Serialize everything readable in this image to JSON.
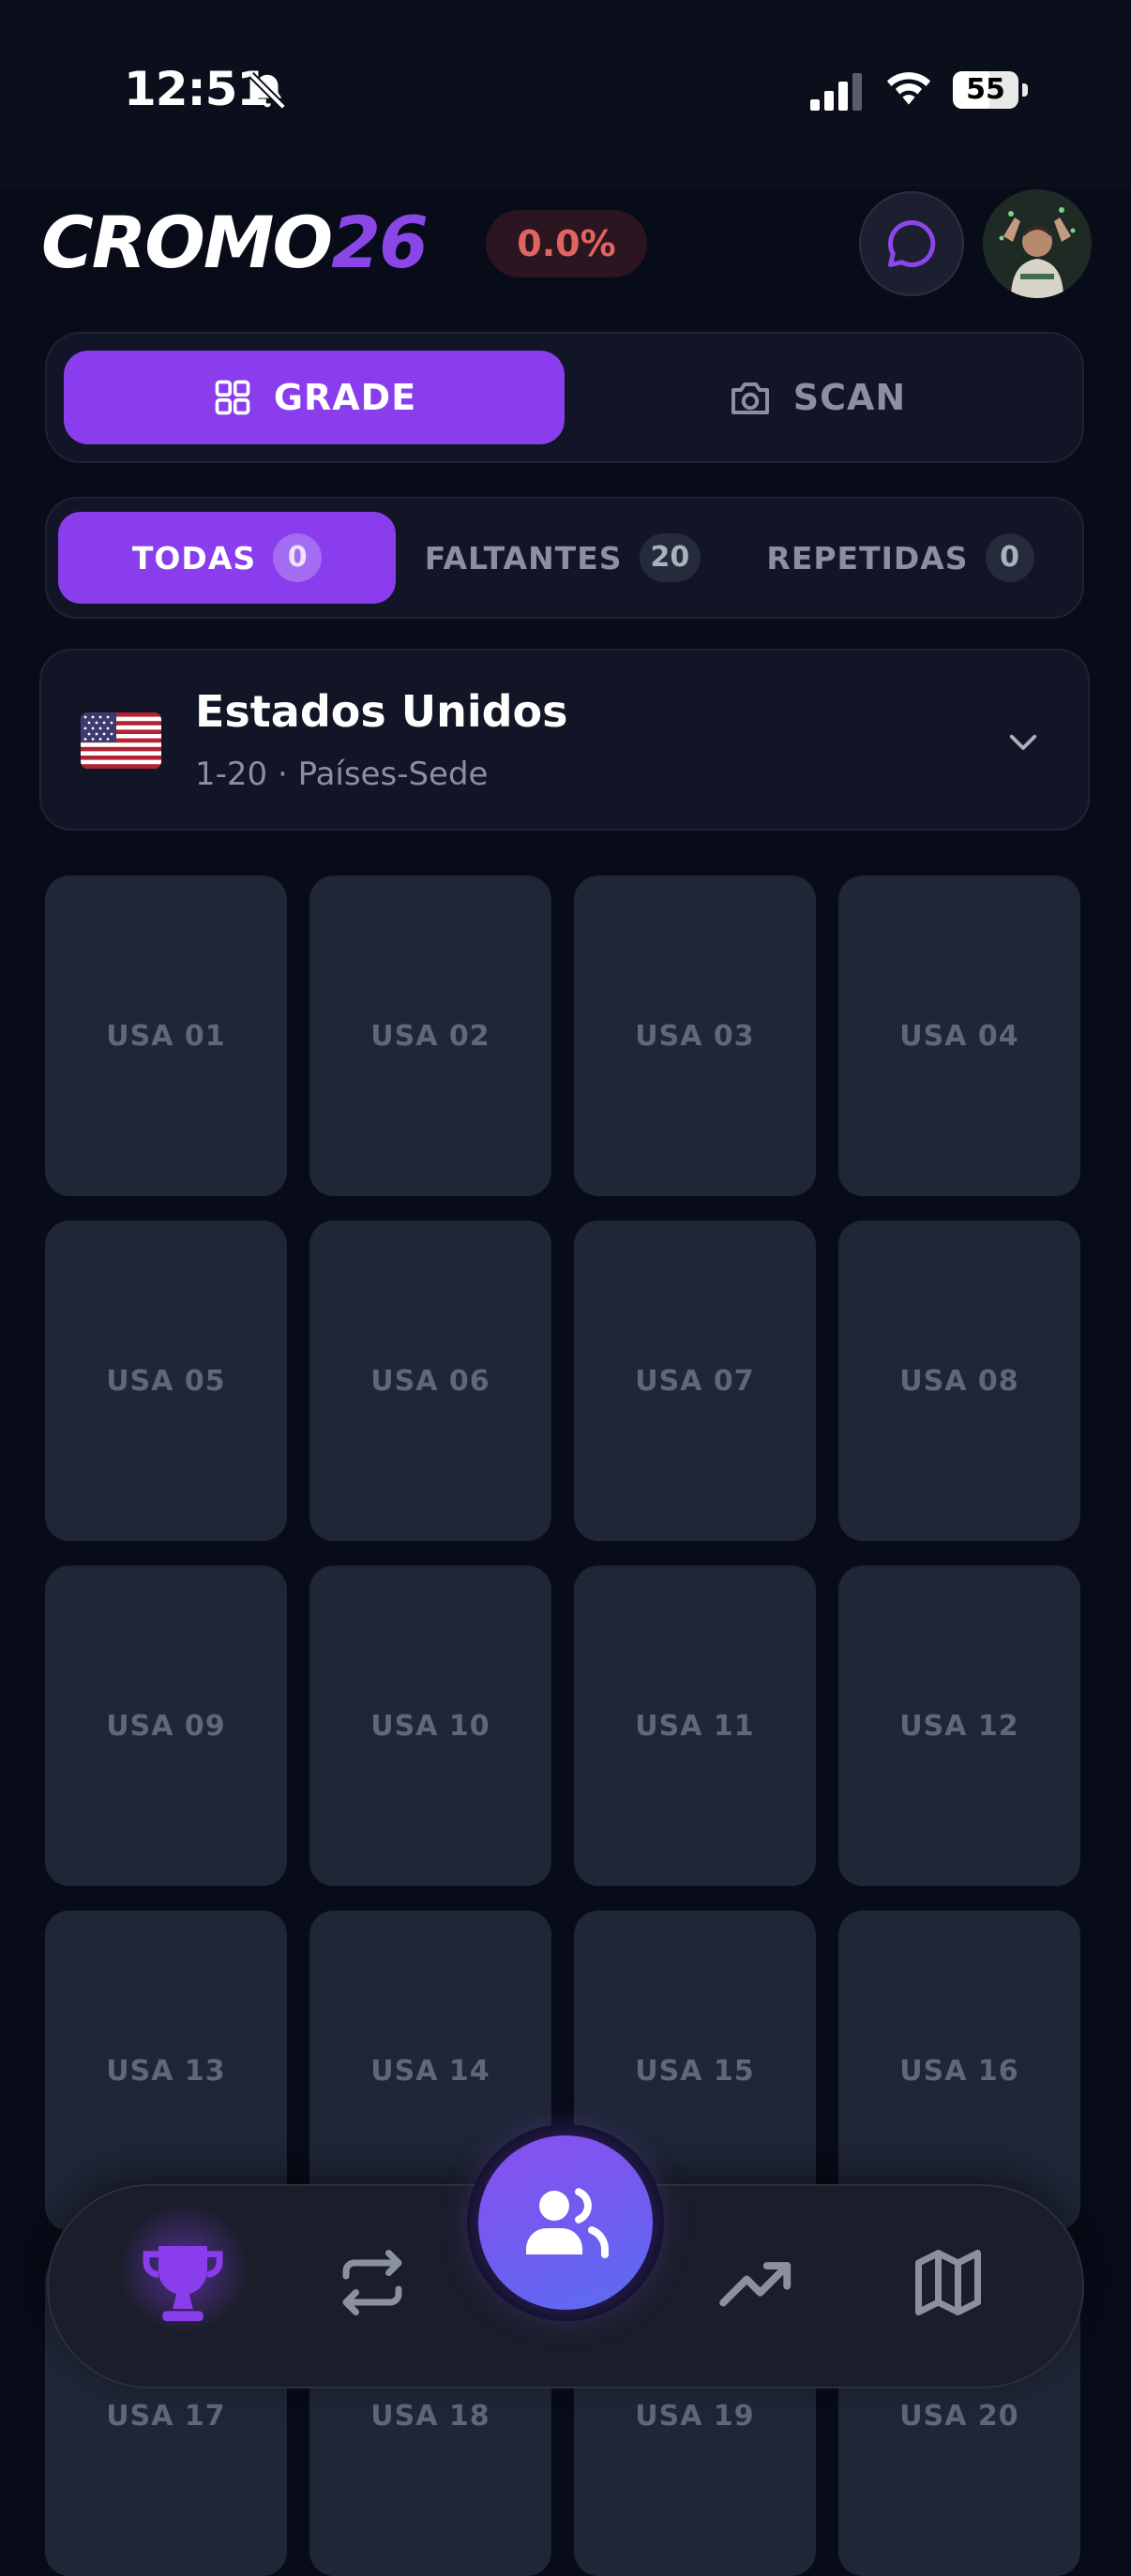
{
  "status_bar": {
    "time": "12:51",
    "battery": "55",
    "battery_level": 0.55
  },
  "header": {
    "logo_part1": "CROMO",
    "logo_part2": "26",
    "progress": "0.0%"
  },
  "mode_toggle": {
    "grade_label": "GRADE",
    "scan_label": "SCAN",
    "active": "GRADE"
  },
  "filters": [
    {
      "label": "TODAS",
      "count": "0",
      "active": true
    },
    {
      "label": "FALTANTES",
      "count": "20",
      "active": false
    },
    {
      "label": "REPETIDAS",
      "count": "0",
      "active": false
    }
  ],
  "country": {
    "name": "Estados Unidos",
    "subtitle": "1-20 · Países-Sede"
  },
  "stickers": [
    "USA 01",
    "USA 02",
    "USA 03",
    "USA 04",
    "USA 05",
    "USA 06",
    "USA 07",
    "USA 08",
    "USA 09",
    "USA 10",
    "USA 11",
    "USA 12",
    "USA 13",
    "USA 14",
    "USA 15",
    "USA 16",
    "USA 17",
    "USA 18",
    "USA 19",
    "USA 20"
  ],
  "nav": {
    "items": [
      "trophy-icon",
      "swap-icon",
      "users-icon",
      "trending-up-icon",
      "map-icon"
    ],
    "accent": "#8a3ded"
  },
  "colors": {
    "background": "#080b18",
    "accent": "#8a3ded",
    "progress_text": "#e0645f"
  }
}
